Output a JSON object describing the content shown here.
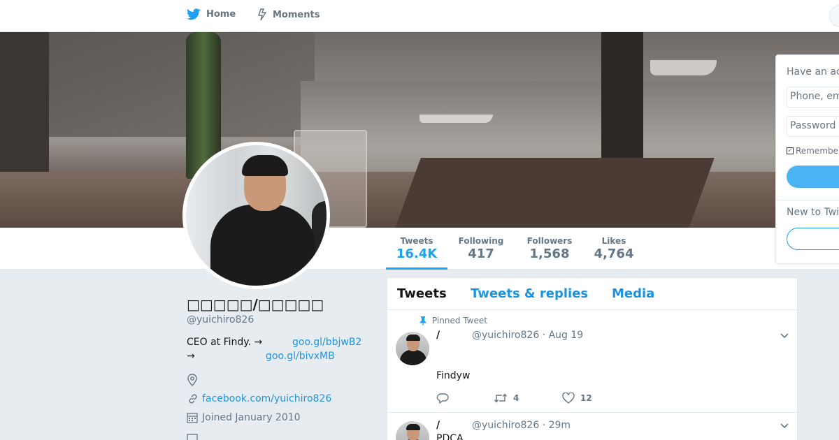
{
  "nav": {
    "home_label": "Home",
    "moments_label": "Moments"
  },
  "profile": {
    "name": "□□□□□/□□□□□",
    "handle": "@yuichiro826",
    "bio_line1": "CEO at Findy. →",
    "bio_link1": "goo.gl/bbjwB2",
    "bio_line2": "→",
    "bio_link2": "goo.gl/bivxMB",
    "website": "facebook.com/yuichiro826",
    "joined": "Joined January 2010"
  },
  "stats": [
    {
      "label": "Tweets",
      "value": "16.4K"
    },
    {
      "label": "Following",
      "value": "417"
    },
    {
      "label": "Followers",
      "value": "1,568"
    },
    {
      "label": "Likes",
      "value": "4,764"
    }
  ],
  "timeline": {
    "tabs": [
      "Tweets",
      "Tweets & replies",
      "Media"
    ],
    "tweets": [
      {
        "pinned_label": "Pinned Tweet",
        "name": "/",
        "meta": "@yuichiro826 · Aug 19",
        "text": "Findyw",
        "retweets": "4",
        "likes": "12"
      },
      {
        "name": "/",
        "meta": "@yuichiro826 · 29m",
        "text": "PDCA"
      }
    ]
  },
  "login": {
    "have_account": "Have an ac",
    "phone_placeholder": "Phone, em",
    "password_placeholder": "Password",
    "remember_label": "Remember",
    "new_to": "New to Twi"
  },
  "colors": {
    "accent": "#1da1f2",
    "link": "#1b95e0",
    "page_bg": "#e6ecf0"
  }
}
